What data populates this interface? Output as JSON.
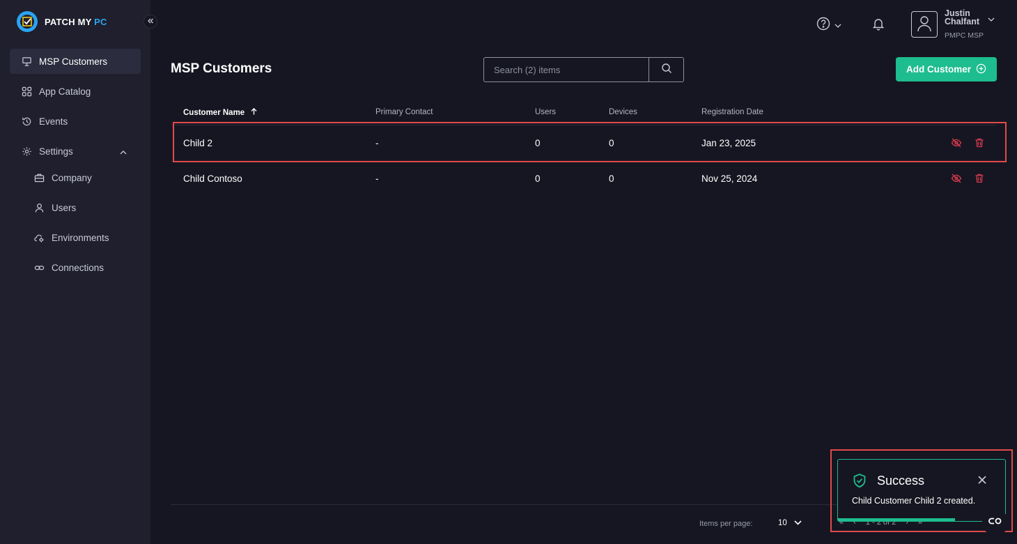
{
  "brand": {
    "name_main": "PATCH MY ",
    "name_accent": "PC",
    "accent_color": "#2ba3f0"
  },
  "sidebar": {
    "items": [
      {
        "label": "MSP Customers",
        "icon": "monitor-users-icon",
        "active": true
      },
      {
        "label": "App Catalog",
        "icon": "grid-icon"
      },
      {
        "label": "Events",
        "icon": "history-icon"
      },
      {
        "label": "Settings",
        "icon": "gear-icon"
      },
      {
        "label": "Company",
        "icon": "briefcase-icon"
      },
      {
        "label": "Users",
        "icon": "user-icon"
      },
      {
        "label": "Environments",
        "icon": "cloud-gear-icon"
      },
      {
        "label": "Connections",
        "icon": "link-icon"
      }
    ]
  },
  "header": {
    "user_name": "Justin Chalfant",
    "user_org": "PMPC MSP"
  },
  "main": {
    "title": "MSP Customers",
    "search_placeholder": "Search (2) items",
    "add_button": "Add Customer",
    "columns": [
      "Customer Name",
      "Primary Contact",
      "Users",
      "Devices",
      "Registration Date"
    ],
    "rows": [
      {
        "name": "Child 2",
        "contact": "-",
        "users": "0",
        "devices": "0",
        "date": "Jan 23, 2025"
      },
      {
        "name": "Child Contoso",
        "contact": "-",
        "users": "0",
        "devices": "0",
        "date": "Nov 25, 2024"
      }
    ]
  },
  "footer": {
    "items_per_page_label": "Items per page:",
    "items_per_page_value": "10",
    "range": "1 - 2 of 2"
  },
  "toast": {
    "title": "Success",
    "message": "Child Customer Child 2 created.",
    "progress": 0.7,
    "color": "#1ebd8f"
  }
}
